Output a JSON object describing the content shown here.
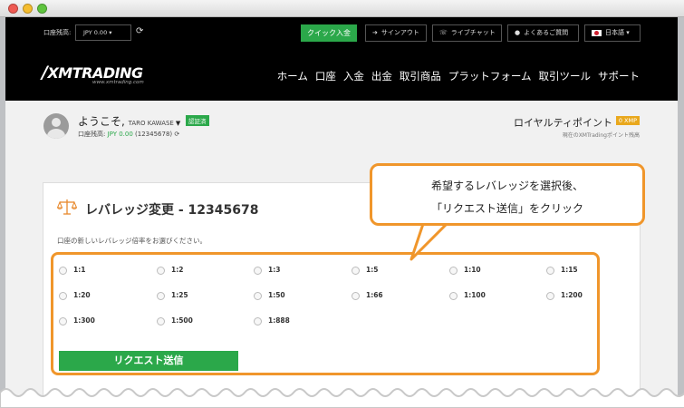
{
  "topbar": {
    "balance_label": "口座残高:",
    "currency_select": "JPY 0.00 ▾",
    "quick_deposit": "クイック入金",
    "signout": "サインアウト",
    "livechat": "ライブチャット",
    "faq": "よくあるご質問",
    "language": "日本語 ▾"
  },
  "logo": {
    "text": "XMTRADING",
    "sub": "www.xmtrading.com"
  },
  "nav": [
    "ホーム",
    "口座",
    "入金",
    "出金",
    "取引商品",
    "プラットフォーム",
    "取引ツール",
    "サポート"
  ],
  "user": {
    "welcome": "ようこそ,",
    "name": "TARO KAWASE",
    "verified": "認証済",
    "balance_label": "口座残高:",
    "balance_value": "JPY 0.00",
    "account_no": "(12345678)"
  },
  "loyalty": {
    "title": "ロイヤルティポイント",
    "points": "0 XMP",
    "sub": "現在のXMTradingポイント残高"
  },
  "card": {
    "title": "レバレッジ変更 - 12345678",
    "desc": "口座の新しいレバレッジ倍率をお選びください。",
    "options": [
      "1:1",
      "1:2",
      "1:3",
      "1:5",
      "1:10",
      "1:15",
      "1:20",
      "1:25",
      "1:50",
      "1:66",
      "1:100",
      "1:200",
      "1:300",
      "1:500",
      "1:888"
    ],
    "submit": "リクエスト送信"
  },
  "callout": {
    "line1": "希望するレバレッジを選択後、",
    "line2": "「リクエスト送信」をクリック"
  },
  "colors": {
    "accent_green": "#2ba84a",
    "highlight_orange": "#f0962b",
    "header_bg": "#000000"
  }
}
